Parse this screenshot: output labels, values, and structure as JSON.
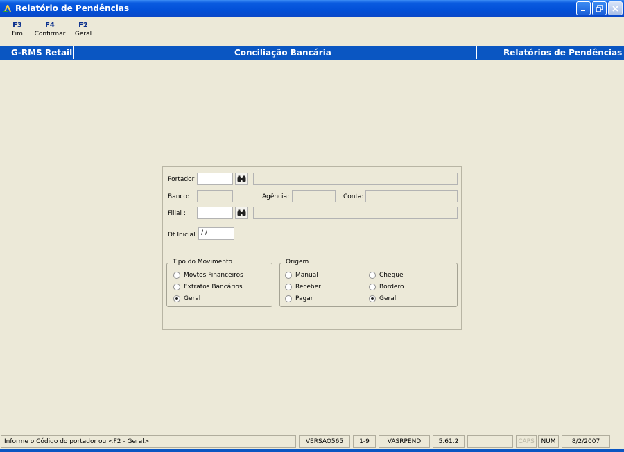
{
  "window": {
    "title": "Relatório de Pendências"
  },
  "toolbar": [
    {
      "key": "F3",
      "label": "Fim"
    },
    {
      "key": "F4",
      "label": "Confirmar"
    },
    {
      "key": "F2",
      "label": "Geral"
    }
  ],
  "header": {
    "left": "G-RMS Retail",
    "center": "Conciliação Bancária",
    "right": "Relatórios de Pendências"
  },
  "form": {
    "portador_label": "Portador :",
    "banco_label": "Banco:",
    "agencia_label": "Agência:",
    "conta_label": "Conta:",
    "filial_label": "Filial :",
    "dt_inicial_label": "Dt Inicial :",
    "dt_inicial_value": " / /",
    "tipo_movimento": {
      "legend": "Tipo do Movimento",
      "options": [
        "Movtos Financeiros",
        "Extratos Bancários",
        "Geral"
      ],
      "selected": "Geral"
    },
    "origem": {
      "legend": "Origem",
      "options": [
        "Manual",
        "Cheque",
        "Receber",
        "Bordero",
        "Pagar",
        "Geral"
      ],
      "selected": "Geral"
    }
  },
  "status": {
    "message": "Informe o Código do portador ou <F2 - Geral>",
    "version": "VERSAO565",
    "page": "1-9",
    "program": "VASRPEND",
    "build": "5.61.2",
    "caps": "CAPS",
    "num": "NUM",
    "date": "8/2/2007"
  }
}
